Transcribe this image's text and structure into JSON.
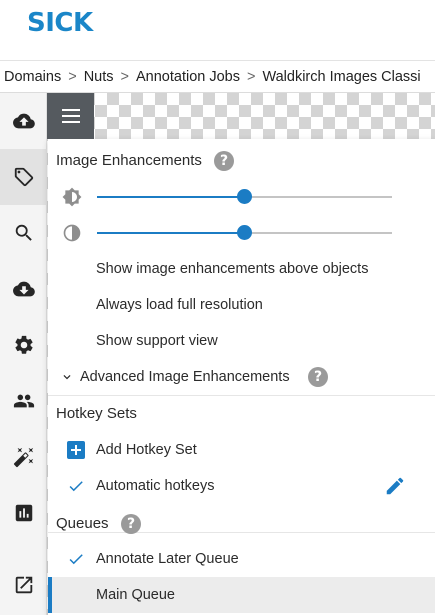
{
  "header": {
    "logo_text": "SICK",
    "brand_color": "#1a86c8"
  },
  "breadcrumb": {
    "items": [
      "Domains",
      "Nuts",
      "Annotation Jobs",
      "Waldkirch Images Classi"
    ],
    "separator": ">"
  },
  "leftnav": {
    "items": [
      {
        "icon": "cloud-upload-icon",
        "active": false
      },
      {
        "icon": "tags-icon",
        "active": true
      },
      {
        "icon": "search-icon",
        "active": false
      },
      {
        "icon": "cloud-download-icon",
        "active": false
      },
      {
        "icon": "gear-icon",
        "active": false
      },
      {
        "icon": "users-icon",
        "active": false
      },
      {
        "icon": "magic-wand-icon",
        "active": false
      },
      {
        "icon": "bar-chart-icon",
        "active": false
      },
      {
        "icon": "external-link-icon",
        "active": false
      }
    ]
  },
  "menu": {
    "image_enhancements": {
      "title": "Image Enhancements",
      "help": "?",
      "brightness_icon": "brightness-icon",
      "brightness_value": 0.5,
      "contrast_icon": "contrast-icon",
      "contrast_value": 0.5,
      "options": [
        "Show image enhancements above objects",
        "Always load full resolution",
        "Show support view"
      ],
      "advanced_label": "Advanced Image Enhancements",
      "advanced_help": "?"
    },
    "hotkey_sets": {
      "title": "Hotkey Sets",
      "add_label": "Add Hotkey Set",
      "sets": [
        {
          "label": "Automatic hotkeys",
          "checked": true
        }
      ]
    },
    "queues": {
      "title": "Queues",
      "help": "?",
      "items": [
        {
          "label": "Annotate Later Queue",
          "checked": true
        },
        {
          "label": "Main Queue",
          "selected": true
        }
      ]
    }
  },
  "colors": {
    "accent": "#1b7cc4",
    "toggle_bg": "#555a5f",
    "help_bg": "#9a9a9a"
  }
}
